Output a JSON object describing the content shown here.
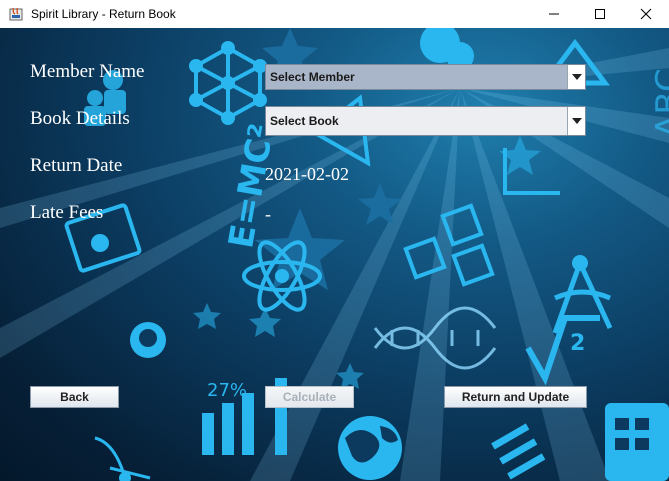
{
  "window": {
    "title": "Spirit Library - Return Book",
    "minimize_glyph": "—",
    "maximize_glyph": "☐",
    "close_glyph": "✕"
  },
  "form": {
    "member_label": "Member Name",
    "book_label": "Book Details",
    "return_date_label": "Return Date",
    "late_fees_label": "Late Fees",
    "member_select": {
      "value": "Select Member"
    },
    "book_select": {
      "value": "Select Book"
    },
    "return_date_value": "2021-02-02",
    "late_fees_value": "-"
  },
  "buttons": {
    "back": "Back",
    "calculate": "Calculate",
    "return_update": "Return and Update"
  },
  "background": {
    "percent_label": "27%",
    "formula_label": "E=MC²",
    "abc_label": "ABC",
    "accent_color": "#2ab7f0"
  }
}
